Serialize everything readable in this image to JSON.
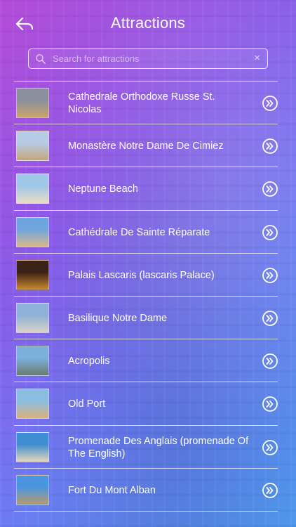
{
  "header": {
    "title": "Attractions",
    "back_icon": "back-arrow-icon"
  },
  "search": {
    "placeholder": "Search for attractions",
    "value": "",
    "clear_glyph": "×"
  },
  "colors": {
    "gradient_start": "#b44bd9",
    "gradient_end": "#4f9bf0",
    "text": "#ffffff"
  },
  "attractions": [
    {
      "label": "Cathedrale Orthodoxe Russe St. Nicolas",
      "thumb_a": "#8a8f9c",
      "thumb_b": "#c8a46a"
    },
    {
      "label": "Monastère Notre Dame De Cimiez",
      "thumb_a": "#b6cbe6",
      "thumb_b": "#c7a57a"
    },
    {
      "label": "Neptune Beach",
      "thumb_a": "#9fc7e8",
      "thumb_b": "#e9dcc6"
    },
    {
      "label": "Cathédrale De Sainte Réparate",
      "thumb_a": "#6fa5de",
      "thumb_b": "#d8b98a"
    },
    {
      "label": "Palais Lascaris (lascaris Palace)",
      "thumb_a": "#3b2218",
      "thumb_b": "#c9882e"
    },
    {
      "label": "Basilique Notre Dame",
      "thumb_a": "#8fb0d8",
      "thumb_b": "#d9d2c5"
    },
    {
      "label": "Acropolis",
      "thumb_a": "#7bb0dd",
      "thumb_b": "#6c7a6b"
    },
    {
      "label": "Old Port",
      "thumb_a": "#8bbde3",
      "thumb_b": "#d7b27c"
    },
    {
      "label": "Promenade Des Anglais (promenade Of The English)",
      "thumb_a": "#3f8ed1",
      "thumb_b": "#e6d6b8"
    },
    {
      "label": "Fort Du Mont Alban",
      "thumb_a": "#4b95e0",
      "thumb_b": "#b99a6e"
    }
  ]
}
